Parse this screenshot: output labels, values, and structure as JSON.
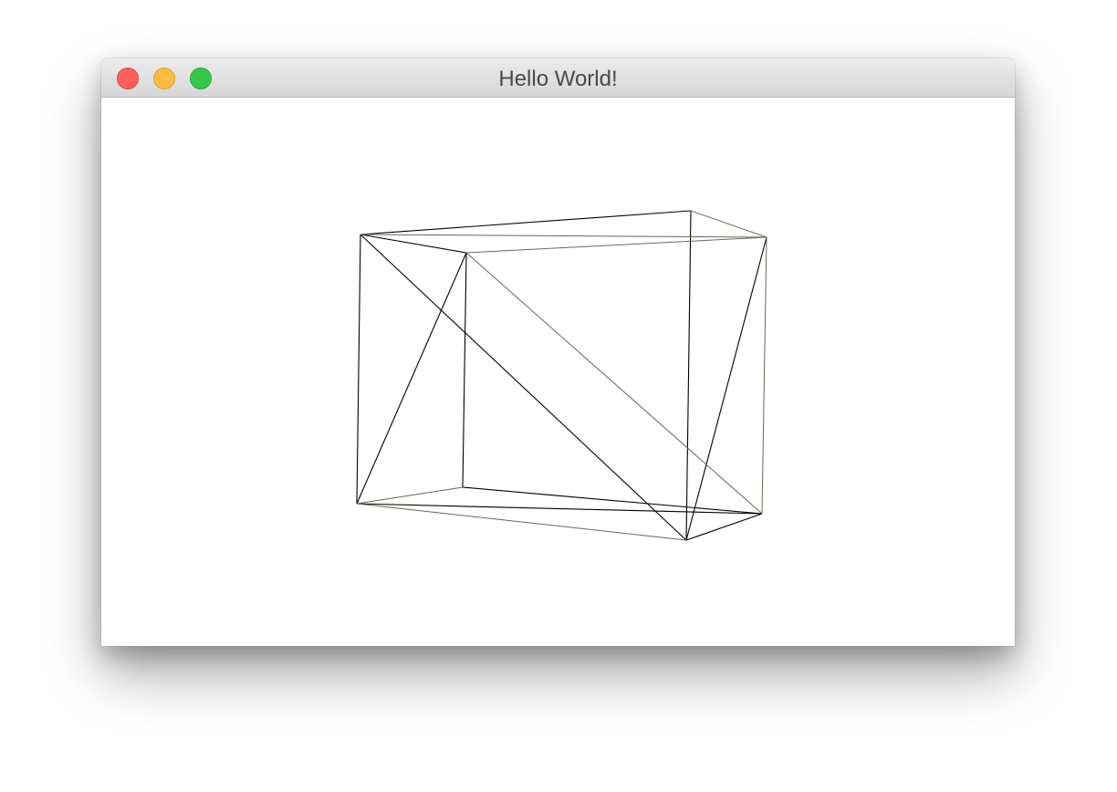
{
  "window": {
    "title": "Hello World!",
    "controls": {
      "close": "close-button",
      "minimize": "minimize-button",
      "zoom": "zoom-button"
    },
    "colors": {
      "close": "#fc605c",
      "minimize": "#fdbc40",
      "zoom": "#34c84a",
      "stroke_dark": "#000000",
      "stroke_light": "#6b6754"
    }
  },
  "canvas": {
    "content": "wireframe-cube"
  }
}
